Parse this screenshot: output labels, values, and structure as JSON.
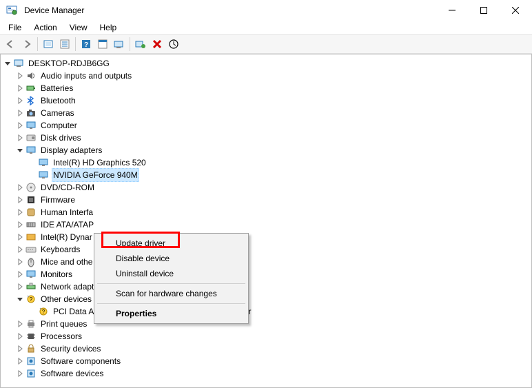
{
  "window": {
    "title": "Device Manager"
  },
  "menu": [
    "File",
    "Action",
    "View",
    "Help"
  ],
  "root": "DESKTOP-RDJB6GG",
  "categories": [
    {
      "label": "Audio inputs and outputs",
      "expanded": false,
      "icon": "speaker"
    },
    {
      "label": "Batteries",
      "expanded": false,
      "icon": "battery"
    },
    {
      "label": "Bluetooth",
      "expanded": false,
      "icon": "bluetooth"
    },
    {
      "label": "Cameras",
      "expanded": false,
      "icon": "camera"
    },
    {
      "label": "Computer",
      "expanded": false,
      "icon": "monitor"
    },
    {
      "label": "Disk drives",
      "expanded": false,
      "icon": "disk"
    },
    {
      "label": "Display adapters",
      "expanded": true,
      "icon": "monitor",
      "children": [
        {
          "label": "Intel(R) HD Graphics 520",
          "icon": "monitor"
        },
        {
          "label": "NVIDIA GeForce 940M",
          "icon": "monitor",
          "selected": true
        }
      ]
    },
    {
      "label": "DVD/CD-ROM",
      "expanded": false,
      "icon": "optical"
    },
    {
      "label": "Firmware",
      "expanded": false,
      "icon": "chip"
    },
    {
      "label": "Human Interfa",
      "expanded": false,
      "icon": "hid"
    },
    {
      "label": "IDE ATA/ATAP",
      "expanded": false,
      "icon": "ide"
    },
    {
      "label": "Intel(R) Dynar",
      "expanded": false,
      "icon": "intel"
    },
    {
      "label": "Keyboards",
      "expanded": false,
      "icon": "keyboard"
    },
    {
      "label": "Mice and othe",
      "expanded": false,
      "icon": "mouse"
    },
    {
      "label": "Monitors",
      "expanded": false,
      "icon": "monitor"
    },
    {
      "label": "Network adapters",
      "expanded": false,
      "icon": "network"
    },
    {
      "label": "Other devices",
      "expanded": true,
      "icon": "warn",
      "children": [
        {
          "label": "PCI Data Acquisition and Signal Processing Controller",
          "icon": "warn"
        }
      ]
    },
    {
      "label": "Print queues",
      "expanded": false,
      "icon": "printer"
    },
    {
      "label": "Processors",
      "expanded": false,
      "icon": "cpu"
    },
    {
      "label": "Security devices",
      "expanded": false,
      "icon": "security"
    },
    {
      "label": "Software components",
      "expanded": false,
      "icon": "component"
    },
    {
      "label": "Software devices",
      "expanded": false,
      "icon": "component"
    }
  ],
  "context_menu": {
    "items": [
      {
        "label": "Update driver",
        "highlighted": true
      },
      {
        "label": "Disable device"
      },
      {
        "label": "Uninstall device"
      },
      {
        "divider": true
      },
      {
        "label": "Scan for hardware changes"
      },
      {
        "divider": true
      },
      {
        "label": "Properties",
        "bold": true
      }
    ]
  },
  "icons": {
    "app": "device-manager",
    "toolbar": [
      "back",
      "forward",
      "|",
      "show-hidden",
      "properties",
      "|",
      "help",
      "action-center",
      "monitor-action",
      "|",
      "scan",
      "uninstall",
      "enable"
    ]
  }
}
